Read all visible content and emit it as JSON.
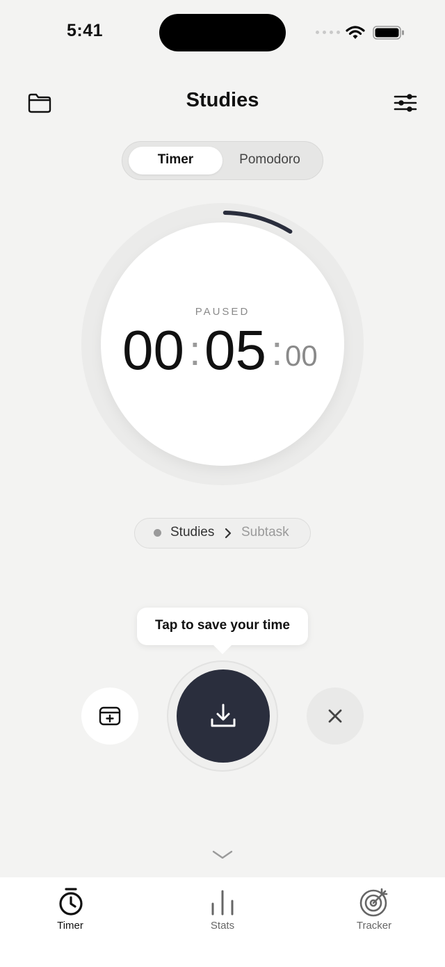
{
  "status_bar": {
    "time": "5:41"
  },
  "header": {
    "title": "Studies",
    "left_icon": "folder-icon",
    "right_icon": "sliders-icon"
  },
  "mode_switch": {
    "options": [
      "Timer",
      "Pomodoro"
    ],
    "selected": "Timer"
  },
  "timer": {
    "state": "PAUSED",
    "hours": "00",
    "minutes": "05",
    "seconds": "00",
    "progress_fraction": 0.083
  },
  "task_chip": {
    "project": "Studies",
    "separator_icon": "chevron-right-icon",
    "subtask": "Subtask"
  },
  "tooltip": {
    "text": "Tap to save your time"
  },
  "actions": {
    "left_icon": "add-entry-icon",
    "main_icon": "download-icon",
    "right_icon": "close-icon"
  },
  "collapse_icon": "chevron-down-icon",
  "tab_bar": {
    "tabs": [
      {
        "label": "Timer",
        "icon": "stopwatch-icon",
        "active": true
      },
      {
        "label": "Stats",
        "icon": "bar-chart-icon",
        "active": false
      },
      {
        "label": "Tracker",
        "icon": "target-icon",
        "active": false
      }
    ]
  },
  "colors": {
    "background": "#f3f3f2",
    "accent": "#2a2e3d",
    "progress": "#2a2e3d"
  }
}
